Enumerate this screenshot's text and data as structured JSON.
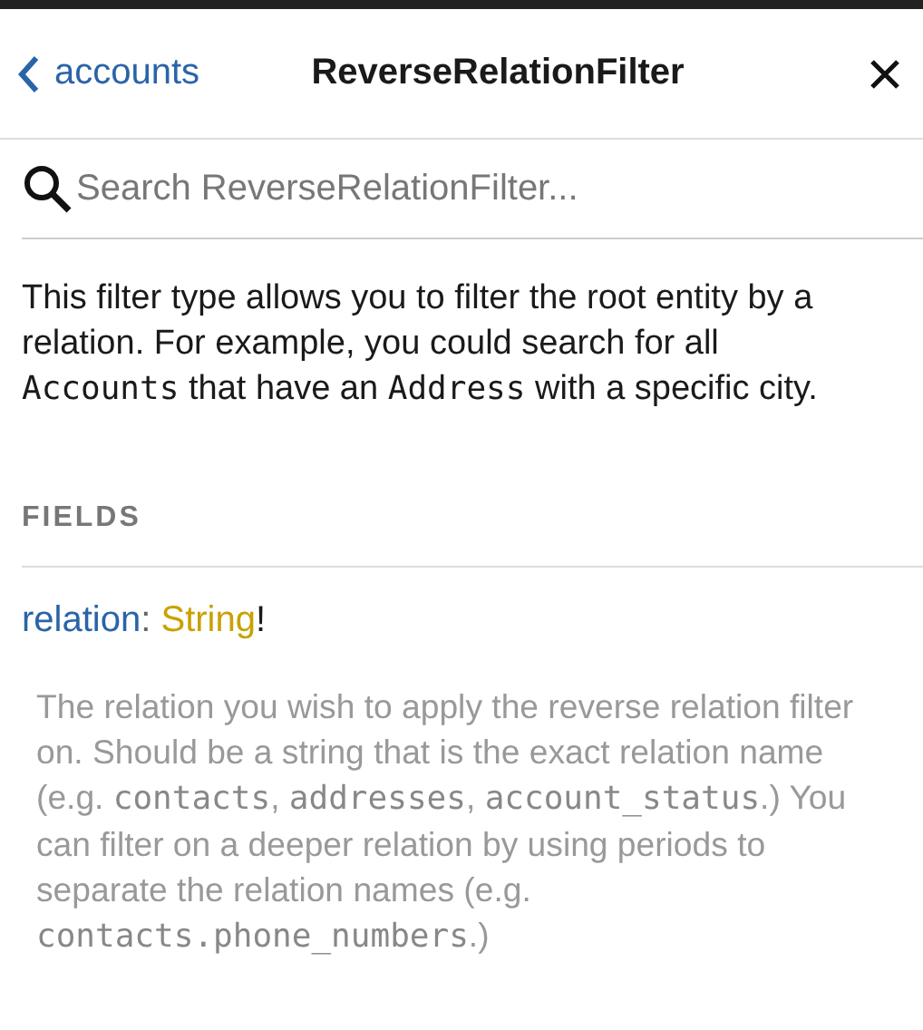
{
  "header": {
    "back_label": "accounts",
    "title": "ReverseRelationFilter"
  },
  "search": {
    "placeholder": "Search ReverseRelationFilter..."
  },
  "description": [
    {
      "kind": "text",
      "text": "This filter type allows you to filter the root entity by a relation. For example, you could search for all "
    },
    {
      "kind": "code",
      "text": "Accounts"
    },
    {
      "kind": "text",
      "text": " that have an "
    },
    {
      "kind": "code",
      "text": "Address"
    },
    {
      "kind": "text",
      "text": " with a specific city."
    }
  ],
  "section_title": "FIELDS",
  "fields": [
    {
      "name": "relation",
      "separator": ":",
      "type": "String",
      "required_mark": "!",
      "description": [
        {
          "kind": "text",
          "text": "The relation you wish to apply the reverse relation filter on. Should be a string that is the exact relation name (e.g. "
        },
        {
          "kind": "code",
          "text": "contacts"
        },
        {
          "kind": "text",
          "text": ", "
        },
        {
          "kind": "code",
          "text": "addresses"
        },
        {
          "kind": "text",
          "text": ", "
        },
        {
          "kind": "code",
          "text": "account_status"
        },
        {
          "kind": "text",
          "text": ".) You can filter on a deeper relation by using periods to separate the relation names (e.g. "
        },
        {
          "kind": "code",
          "text": "contacts.phone_numbers"
        },
        {
          "kind": "text",
          "text": ".)"
        }
      ]
    }
  ]
}
